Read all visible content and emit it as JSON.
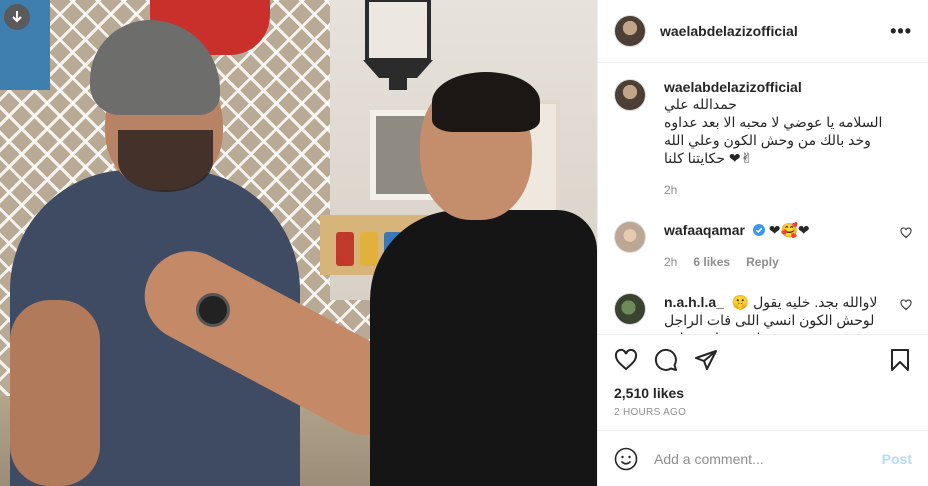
{
  "post": {
    "author": "waelabdelazizofficial",
    "more_icon": "more-horizontal-icon",
    "caption": {
      "username": "waelabdelazizofficial",
      "text": "حمدالله علي\nالسلامه يا عوضي لا محبه الا بعد عداوه\nوخد بالك من وحش الكون وعلي الله\n✌❤ حكايتنا كلنا",
      "time": "2h"
    },
    "comments": [
      {
        "username": "wafaaqamar",
        "verified": true,
        "text": "❤🥰❤",
        "time": "2h",
        "likes": "6 likes",
        "reply": "Reply"
      },
      {
        "username": "n.a.h.l.a_",
        "verified": false,
        "text": "لاوالله بجد. خليه يقول 🤫\nلوحش الكون انسي اللى فات الراجل\nاتحوز واحده تانيه",
        "time": "",
        "likes": "",
        "reply": ""
      }
    ],
    "likes_count": "2,510 likes",
    "posted_ago": "2 HOURS AGO",
    "add_comment_placeholder": "Add a comment...",
    "post_button": "Post"
  },
  "colors": {
    "link_blue_disabled": "#b3dbff",
    "muted_gray": "#8e8e8e",
    "heart_red": "#ed4956",
    "verified_blue": "#3897f0"
  }
}
